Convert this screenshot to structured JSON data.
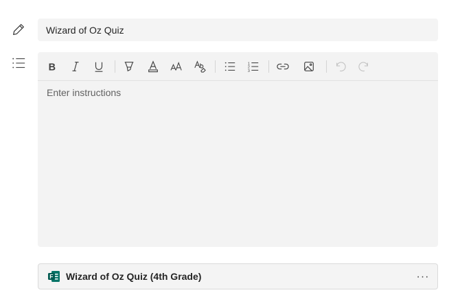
{
  "title_field": {
    "value": "Wizard of Oz Quiz",
    "icon": "pencil-icon"
  },
  "instructions": {
    "placeholder": "Enter instructions",
    "icon": "list-icon"
  },
  "toolbar": {
    "buttons": [
      {
        "name": "bold-icon"
      },
      {
        "name": "italic-icon"
      },
      {
        "name": "underline-icon"
      },
      {
        "name": "highlight-icon"
      },
      {
        "name": "font-color-icon"
      },
      {
        "name": "font-size-icon"
      },
      {
        "name": "clear-formatting-icon"
      },
      {
        "name": "bulleted-list-icon"
      },
      {
        "name": "numbered-list-icon"
      },
      {
        "name": "link-icon"
      },
      {
        "name": "image-icon"
      },
      {
        "name": "undo-icon",
        "disabled": true
      },
      {
        "name": "redo-icon",
        "disabled": true
      }
    ]
  },
  "attachment": {
    "title": "Wizard of Oz Quiz (4th Grade)",
    "icon": "microsoft-forms-icon",
    "menu_label": "···",
    "brand_color": "#077568"
  },
  "colors": {
    "field_background": "#f4f4f4",
    "editor_background": "#f3f3f3",
    "disabled_icon": "#c4c4c4"
  }
}
